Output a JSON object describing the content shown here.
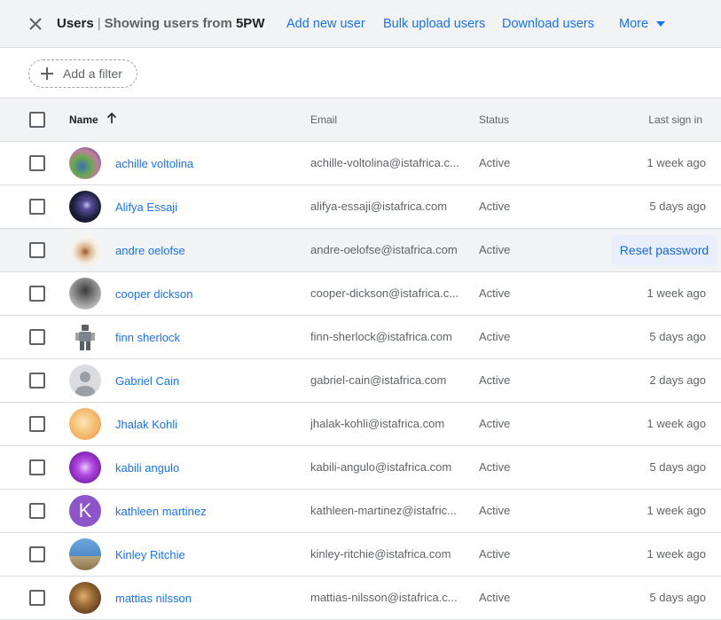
{
  "header": {
    "title": "Users",
    "separator": "|",
    "subtitle": "Showing users from",
    "org": "5PW",
    "actions": [
      "Add new user",
      "Bulk upload users",
      "Download users"
    ],
    "more_label": "More",
    "close_icon": "close-icon",
    "more_icon": "dropdown-arrow-icon"
  },
  "filter": {
    "label": "Add a filter",
    "icon": "plus-icon"
  },
  "table": {
    "columns": {
      "name": "Name",
      "email": "Email",
      "status": "Status",
      "last_sign_in": "Last sign in"
    },
    "sort_icon": "arrow-up-icon",
    "row_hover_action": "Reset password",
    "users": [
      {
        "name": "achille voltolina",
        "email": "achille-voltolina@istafrica.c...",
        "status": "Active",
        "last_sign_in": "1 week ago",
        "avatar_color": "#4a7c59"
      },
      {
        "name": "Alifya Essaji",
        "email": "alifya-essaji@istafrica.com",
        "status": "Active",
        "last_sign_in": "5 days ago",
        "avatar_color": "#1c1f3a"
      },
      {
        "name": "andre oelofse",
        "email": "andre-oelofse@istafrica.com",
        "status": "Active",
        "last_sign_in": "",
        "avatar_color": "#e8d6c4"
      },
      {
        "name": "cooper dickson",
        "email": "cooper-dickson@istafrica.c...",
        "status": "Active",
        "last_sign_in": "1 week ago",
        "avatar_color": "#8a8a8a"
      },
      {
        "name": "finn sherlock",
        "email": "finn-sherlock@istafrica.com",
        "status": "Active",
        "last_sign_in": "5 days ago",
        "avatar_color": "#9ea4a8"
      },
      {
        "name": "Gabriel Cain",
        "email": "gabriel-cain@istafrica.com",
        "status": "Active",
        "last_sign_in": "2 days ago",
        "avatar_color": "#dadce0"
      },
      {
        "name": "Jhalak Kohli",
        "email": "jhalak-kohli@istafrica.com",
        "status": "Active",
        "last_sign_in": "1 week ago",
        "avatar_color": "#f6c47a"
      },
      {
        "name": "kabili angulo",
        "email": "kabili-angulo@istafrica.com",
        "status": "Active",
        "last_sign_in": "5 days ago",
        "avatar_color": "#9b2fd0"
      },
      {
        "name": "kathleen martinez",
        "email": "kathleen-martinez@istafric...",
        "status": "Active",
        "last_sign_in": "1 week ago",
        "avatar_color": "#8e55c9",
        "avatar_letter": "K"
      },
      {
        "name": "Kinley Ritchie",
        "email": "kinley-ritchie@istafrica.com",
        "status": "Active",
        "last_sign_in": "1 week ago",
        "avatar_color": "#4f8bc9"
      },
      {
        "name": "mattias nilsson",
        "email": "mattias-nilsson@istafrica.c...",
        "status": "Active",
        "last_sign_in": "5 days ago",
        "avatar_color": "#7a5a2e"
      }
    ]
  }
}
